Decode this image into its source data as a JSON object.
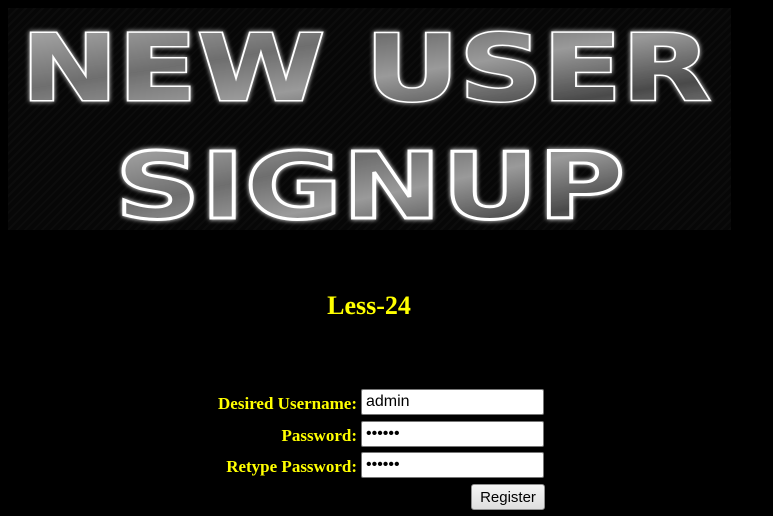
{
  "banner": {
    "line1": "NEW USER",
    "line2": "SIGNUP"
  },
  "lesson": {
    "title": "Less-24"
  },
  "form": {
    "username_label": "Desired Username:",
    "username_value": "admin",
    "password_label": "Password:",
    "password_value": "••••••",
    "retype_label": "Retype Password:",
    "retype_value": "••••••",
    "submit_label": "Register"
  },
  "colors": {
    "background": "#000000",
    "label_text": "#ffff00",
    "banner_stroke": "#ffffff",
    "banner_metal_light": "#a8a8a8",
    "banner_metal_dark": "#3a3a3a"
  }
}
